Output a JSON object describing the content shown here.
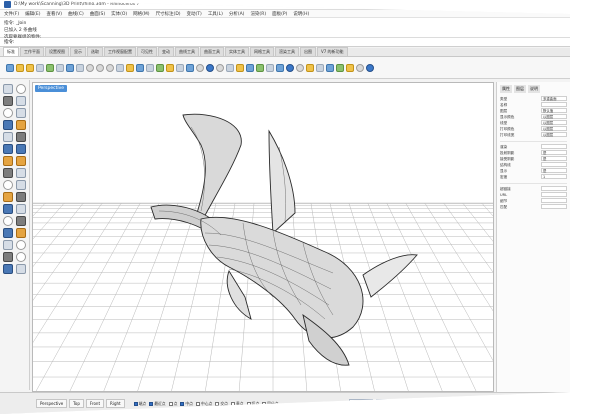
{
  "window": {
    "title": "D:\\My work\\Scanning\\3D Print\\rhino.3dm - Rhinoceros 7"
  },
  "menu": [
    "文件(F)",
    "编辑(E)",
    "查看(V)",
    "曲线(C)",
    "曲面(S)",
    "实体(O)",
    "网格(M)",
    "尺寸标注(D)",
    "变动(T)",
    "工具(L)",
    "分析(A)",
    "渲染(R)",
    "面板(P)",
    "说明(H)"
  ],
  "command": {
    "history": [
      "指令: _Join",
      "已加入 2 条曲线",
      "选取要群组的物件:"
    ],
    "prompt": "指令:"
  },
  "tabs": [
    {
      "label": "标准",
      "active": true
    },
    {
      "label": "工作平面",
      "active": false
    },
    {
      "label": "设置视图",
      "active": false
    },
    {
      "label": "显示",
      "active": false
    },
    {
      "label": "选取",
      "active": false
    },
    {
      "label": "工作视窗配置",
      "active": false
    },
    {
      "label": "可见性",
      "active": false
    },
    {
      "label": "变动",
      "active": false
    },
    {
      "label": "曲线工具",
      "active": false
    },
    {
      "label": "曲面工具",
      "active": false
    },
    {
      "label": "实体工具",
      "active": false
    },
    {
      "label": "网格工具",
      "active": false
    },
    {
      "label": "渲染工具",
      "active": false
    },
    {
      "label": "出图",
      "active": false
    },
    {
      "label": "V7 的新功能",
      "active": false
    }
  ],
  "viewport": {
    "label": "Perspective"
  },
  "properties": {
    "tabs": [
      "属性",
      "图层",
      "说明"
    ],
    "rows": [
      {
        "label": "类型",
        "value": "多重曲面"
      },
      {
        "label": "名称",
        "value": ""
      },
      {
        "label": "图层",
        "value": "默认值"
      },
      {
        "label": "显示颜色",
        "value": "以图层"
      },
      {
        "label": "线型",
        "value": "以图层"
      },
      {
        "label": "打印颜色",
        "value": "以图层"
      },
      {
        "label": "打印线宽",
        "value": "以图层"
      },
      {
        "label": "渲染",
        "value": ""
      },
      {
        "label": "投射阴影",
        "value": "是"
      },
      {
        "label": "接受阴影",
        "value": "是"
      },
      {
        "label": "结构线",
        "value": ""
      },
      {
        "label": "显示",
        "value": "是"
      },
      {
        "label": "密度",
        "value": "1"
      },
      {
        "label": "超链接",
        "value": ""
      },
      {
        "label": "URL",
        "value": ""
      },
      {
        "label": "细节",
        "value": ""
      },
      {
        "label": "匹配",
        "value": ""
      }
    ]
  },
  "status": {
    "views": [
      "Perspective",
      "Top",
      "Front",
      "Right"
    ],
    "snaps": [
      {
        "label": "端点",
        "on": true
      },
      {
        "label": "最近点",
        "on": true
      },
      {
        "label": "点",
        "on": false
      },
      {
        "label": "中点",
        "on": true
      },
      {
        "label": "中心点",
        "on": false
      },
      {
        "label": "交点",
        "on": false
      },
      {
        "label": "垂点",
        "on": false
      },
      {
        "label": "切点",
        "on": false
      },
      {
        "label": "四分点",
        "on": false
      }
    ],
    "modes": [
      {
        "label": "锁定格点",
        "on": false
      },
      {
        "label": "正交",
        "on": false
      },
      {
        "label": "平面模式",
        "on": false
      },
      {
        "label": "物件锁点",
        "on": true
      },
      {
        "label": "智慧轨迹",
        "on": false
      },
      {
        "label": "操作轴",
        "on": true
      },
      {
        "label": "记录建构历史",
        "on": false
      }
    ]
  }
}
